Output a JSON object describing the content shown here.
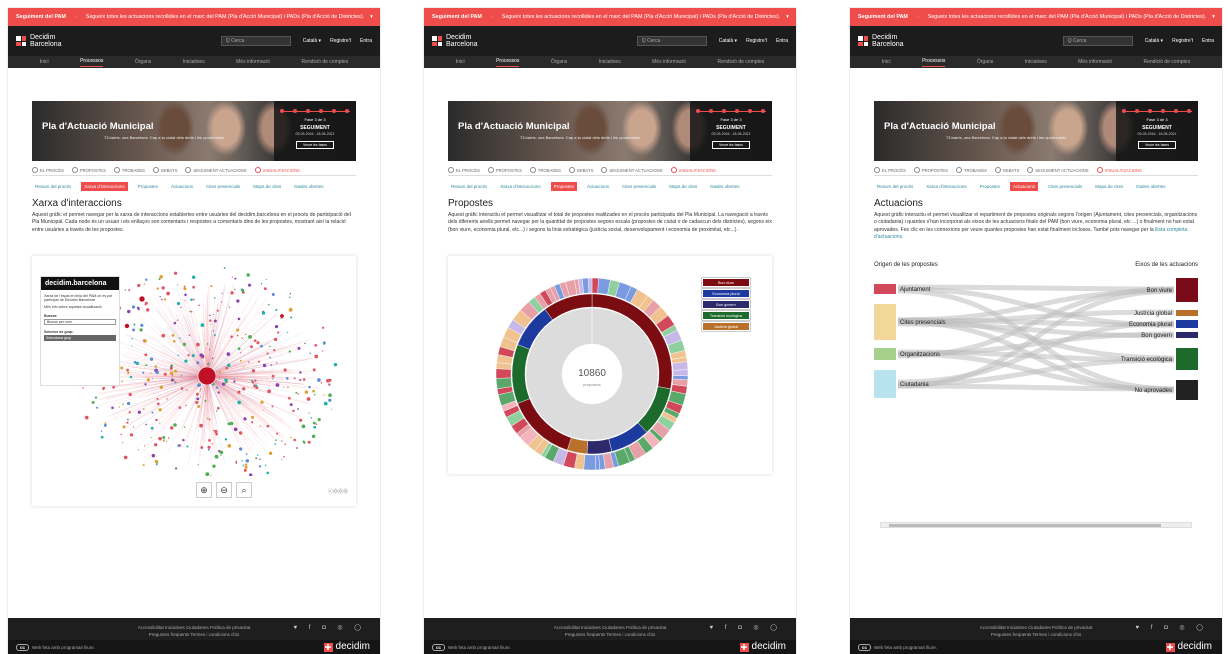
{
  "common": {
    "topbar": {
      "label": "Seguiment del PAM",
      "sep": "·",
      "text": "Segueix totes les actuacions recollides en el marc del PAM (Pla d'Acció Municipal) i PADs (Pla d'Acció de Districtes).",
      "arrow": "▾"
    },
    "logo": {
      "line1": "Decidim",
      "line2": "Barcelona"
    },
    "search_placeholder": "Q  Cerca",
    "header_links": [
      "Català ▾",
      "Registre't",
      "Entra"
    ],
    "nav": [
      "Inici",
      "Processos",
      "Òrgans",
      "Iniciatives",
      "Més informació",
      "Rendició de comptes"
    ],
    "hero": {
      "title": "Pla d'Actuació Municipal",
      "subtitle": "73 barris, una Barcelona. Cap a la ciutat dels drets i les oportunitats.",
      "phase": "Fase 3 de 3",
      "status": "SEGUIMENT",
      "dates": "09-03-2016 - 18-05-2021",
      "button": "Veure les fases"
    },
    "tabs": [
      "EL PROCÉS",
      "PROPOSTES",
      "TROBADES",
      "DEBATS",
      "SEGUIMENT ACTUACIONS",
      "VISUALITZACIONS"
    ],
    "subtabs": [
      "Resum del procés",
      "Xarxa d'interaccions",
      "Propostes",
      "Actuacions",
      "Cites presencials",
      "Mapa de cites",
      "Dades obertes"
    ],
    "footer": {
      "line1": "Accessibilitat    Iniciatives Ciutadanes    Política de privacitat",
      "line2": "Preguntes freqüents    Termes i condicions d'ús",
      "social": "♥ f ◘ ◎ ◯",
      "license": "Web feta amb programari lliure.",
      "brand": "decidim"
    }
  },
  "shot1": {
    "title": "Xarxa d'interaccions",
    "desc": "Aquest gràfic et permet navegar per la xarxa de interaccions establertes entre usuàries del decidim.barcelona en el procés de participació del Pla Municipal. Cada node és un usuari i els enllaços son comentaris i respostes a comentaris dins de les propostes, mostrant així la relació entre usuàries a través de les propostes.",
    "widget": {
      "brand": "decidim.barcelona",
      "info": "Xarxa de l'espai en línia del PAM on es pot participar de Decidim Barcelona",
      "info2": "Més info sobre aquesta visualització",
      "search_label": "Buscar:",
      "search_placeholder": "Buscar per nom",
      "group_label": "Selector de grup:",
      "group_value": "Selecciona grup"
    },
    "zoom": [
      "⊕",
      "⊖",
      "⌕"
    ],
    "badge": "ⓒ⓪⓪⓪"
  },
  "shot2": {
    "title": "Propostes",
    "desc": "Aquest gràfic interactiu et permet visualitzar el total de propostes realitzades en el procés participatiu del Pla Municipal. La navegació a través dels diferents anells permet navegar per la quantitat de propostes segons escala (propostes de ciutat o de cadascun dels districtes), segons eix (bon viure, economia plural, etc...) i segons la línia estratègica (justícia social, desenvolupament i economia de proximitat, etc...).",
    "total": "10860",
    "total_label": "propostes",
    "legend": [
      {
        "label": "Bon viure",
        "color": "#7a0c12"
      },
      {
        "label": "Economia plural",
        "color": "#1d3a9e"
      },
      {
        "label": "Bon govern",
        "color": "#2c2a6a"
      },
      {
        "label": "Transició ecològica",
        "color": "#1d6b2c"
      },
      {
        "label": "Justícia global",
        "color": "#b8702a"
      }
    ]
  },
  "shot3": {
    "title": "Actuacions",
    "desc": "Aquest gràfic interactiu et permet visualitzar el repartiment de propostes originals segons l'origen (Ajuntament, cites presencials, organitzacions o ciutadania) i quantes s'han incorporat als eixos de les actuacions finals del PAM (bon viure, economia plural, etc ...) o finalment no han estat aprovades. Fes clic en les connexions per veure quantes propostes han estat finalment incloses. També pots navegar per la",
    "desc_link": "llista completa d'actuacions.",
    "left_header": "Origen de les propostes",
    "right_header": "Eixos de les actuacions",
    "sources": [
      {
        "label": "Ajuntament",
        "color": "#d0485a"
      },
      {
        "label": "Cites presencials",
        "color": "#f1d79a"
      },
      {
        "label": "Organitzacions",
        "color": "#a8d08d"
      },
      {
        "label": "Ciutadania",
        "color": "#b7e2ee"
      }
    ],
    "targets": [
      {
        "label": "Bon viure",
        "color": "#7a0c1a"
      },
      {
        "label": "Justícia global",
        "color": "#b8702a"
      },
      {
        "label": "Economia plural",
        "color": "#1d3a9e"
      },
      {
        "label": "Bon govern",
        "color": "#2c2a6a"
      },
      {
        "label": "Transició ecològica",
        "color": "#1d6b2c"
      },
      {
        "label": "No aprovades",
        "color": "#222222"
      }
    ]
  }
}
